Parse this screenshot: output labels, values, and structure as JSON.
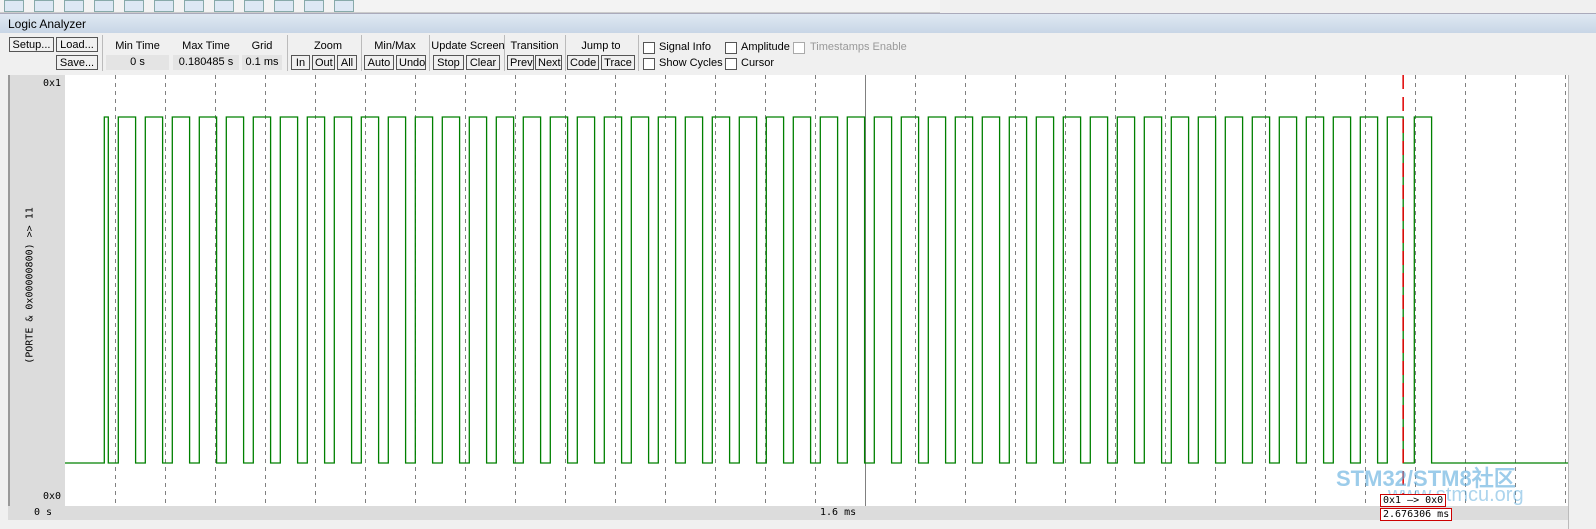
{
  "window": {
    "title": "Logic Analyzer"
  },
  "toolbar_icons": [
    "new-icon",
    "zoom-icon",
    "debug-icon",
    "window-icon",
    "copy-icon",
    "analyzer-icon",
    "memory-icon",
    "print-icon",
    "logic-analyzer-icon",
    "trace-icon",
    "toolbox-icon",
    "settings-icon"
  ],
  "controls": {
    "setup": "Setup...",
    "load": "Load...",
    "save": "Save...",
    "min_time_label": "Min Time",
    "min_time": "0 s",
    "max_time_label": "Max Time",
    "max_time": "0.180485 s",
    "grid_label": "Grid",
    "grid": "0.1 ms",
    "zoom_label": "Zoom",
    "zoom_in": "In",
    "zoom_out": "Out",
    "zoom_all": "All",
    "minmax_label": "Min/Max",
    "auto": "Auto",
    "undo": "Undo",
    "update_label": "Update Screen",
    "stop": "Stop",
    "clear": "Clear",
    "transition_label": "Transition",
    "prev": "Prev",
    "next": "Next",
    "jump_label": "Jump to",
    "code": "Code",
    "trace": "Trace",
    "signal_info": "Signal Info",
    "amplitude": "Amplitude",
    "timestamps": "Timestamps Enable",
    "show_cycles": "Show Cycles",
    "cursor": "Cursor"
  },
  "checkboxes": {
    "signal_info": false,
    "amplitude": false,
    "timestamps": false,
    "show_cycles": false,
    "cursor": false
  },
  "chart_data": {
    "type": "line",
    "signal": "(PORTE & 0x00000800) >> 11",
    "y_top": "0x1",
    "y_bottom": "0x0",
    "x_ticks": [
      {
        "value_ms": 0,
        "label": "0 s"
      },
      {
        "value_ms": 1.6,
        "label": "1.6 ms"
      }
    ],
    "x_range_ms": [
      0,
      3.006
    ],
    "grid_ms": 0.1,
    "grid": true,
    "line_color": "#008000",
    "pulses_ms": [
      [
        0.0786,
        0.0866
      ],
      [
        0.1066,
        0.1412
      ],
      [
        0.1606,
        0.1952
      ],
      [
        0.2146,
        0.2492
      ],
      [
        0.2686,
        0.3032
      ],
      [
        0.3226,
        0.3572
      ],
      [
        0.3766,
        0.4112
      ],
      [
        0.4306,
        0.4652
      ],
      [
        0.4846,
        0.5192
      ],
      [
        0.5386,
        0.5732
      ],
      [
        0.5926,
        0.6272
      ],
      [
        0.6466,
        0.6812
      ],
      [
        0.7006,
        0.7352
      ],
      [
        0.7546,
        0.7892
      ],
      [
        0.8086,
        0.8432
      ],
      [
        0.8626,
        0.8972
      ],
      [
        0.9166,
        0.9512
      ],
      [
        0.9706,
        1.0052
      ],
      [
        1.0246,
        1.0592
      ],
      [
        1.0786,
        1.1132
      ],
      [
        1.1326,
        1.1672
      ],
      [
        1.1866,
        1.2212
      ],
      [
        1.2406,
        1.2752
      ],
      [
        1.2946,
        1.3292
      ],
      [
        1.3486,
        1.3832
      ],
      [
        1.4026,
        1.4372
      ],
      [
        1.4566,
        1.4912
      ],
      [
        1.5106,
        1.5452
      ],
      [
        1.5646,
        1.5992
      ],
      [
        1.6186,
        1.6532
      ],
      [
        1.6726,
        1.7072
      ],
      [
        1.7266,
        1.7612
      ],
      [
        1.7806,
        1.8152
      ],
      [
        1.8346,
        1.8692
      ],
      [
        1.8886,
        1.9232
      ],
      [
        1.9426,
        1.9772
      ],
      [
        1.9966,
        2.0312
      ],
      [
        2.0506,
        2.0852
      ],
      [
        2.1046,
        2.1392
      ],
      [
        2.1586,
        2.1932
      ],
      [
        2.2126,
        2.2472
      ],
      [
        2.2666,
        2.3012
      ],
      [
        2.3206,
        2.3552
      ],
      [
        2.3746,
        2.4092
      ],
      [
        2.4286,
        2.4632
      ],
      [
        2.4826,
        2.5172
      ],
      [
        2.5366,
        2.5712
      ],
      [
        2.5906,
        2.6252
      ],
      [
        2.6446,
        2.6763
      ],
      [
        2.6986,
        2.7332
      ]
    ],
    "cursor": {
      "time_ms": 2.676306,
      "time_label": "2.676306 ms",
      "transition": "0x1 —> 0x0",
      "color": "#e00000"
    }
  },
  "watermark": {
    "line1": "STM32/STM8社区",
    "line2": "www.stmcu.org"
  }
}
